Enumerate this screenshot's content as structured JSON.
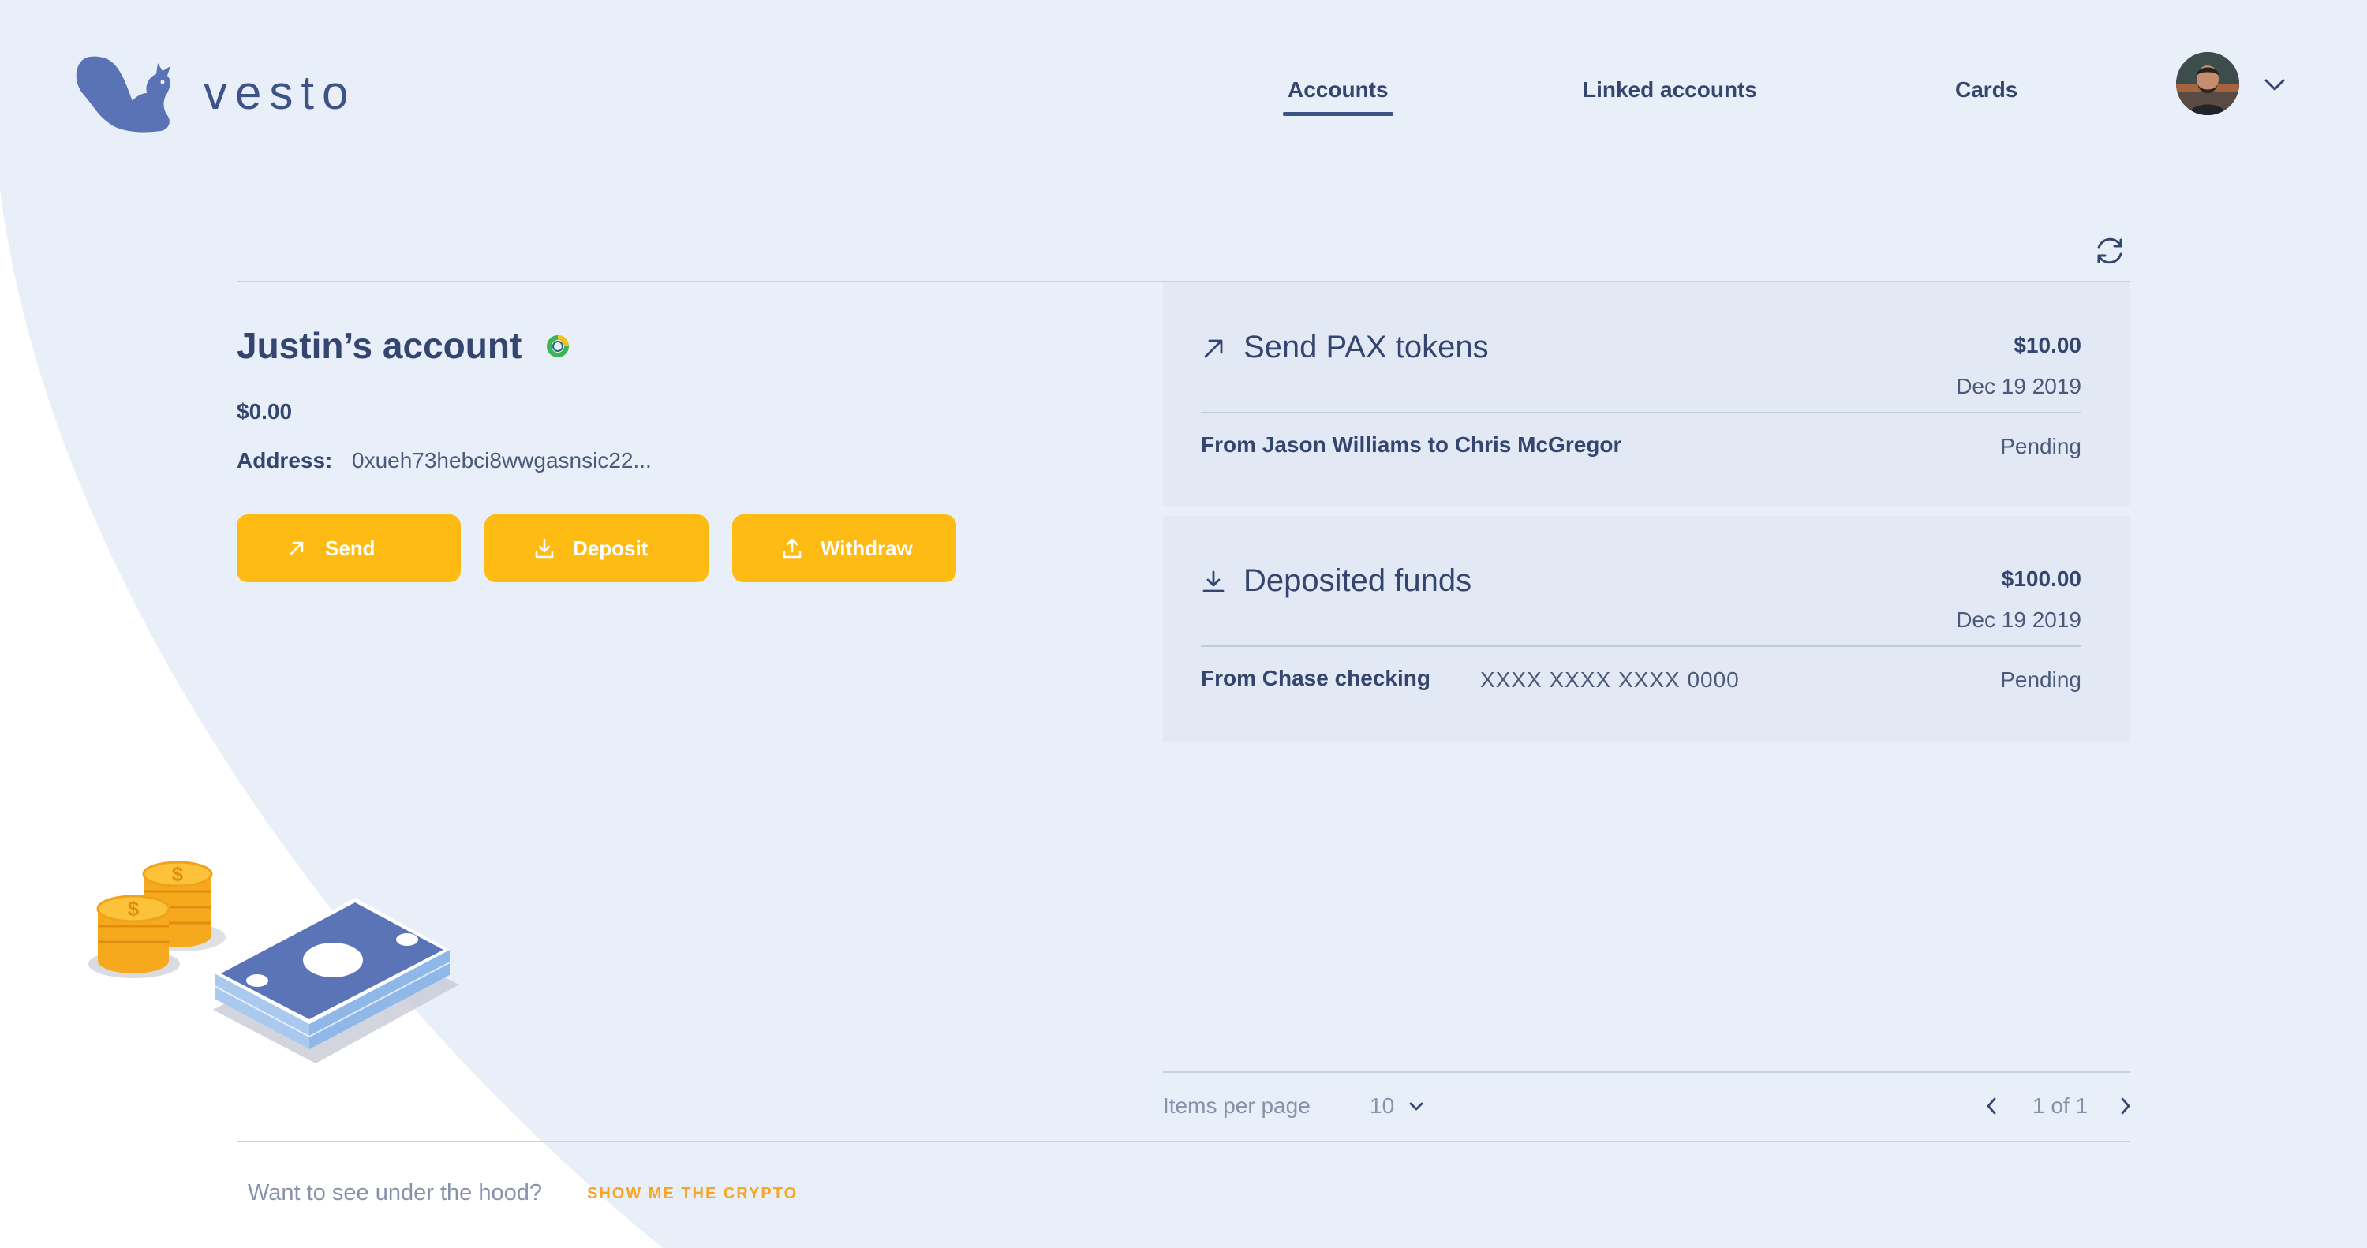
{
  "brand": {
    "name": "vesto"
  },
  "nav": {
    "accounts": "Accounts",
    "linked_accounts": "Linked accounts",
    "cards": "Cards"
  },
  "account": {
    "title": "Justin’s account",
    "balance": "$0.00",
    "address_label": "Address:",
    "address_value": "0xueh73hebci8wwgasnsic22..."
  },
  "actions": {
    "send": "Send",
    "deposit": "Deposit",
    "withdraw": "Withdraw"
  },
  "transactions": [
    {
      "icon": "arrow-up-right-icon",
      "title": "Send PAX tokens",
      "amount": "$10.00",
      "date": "Dec 19 2019",
      "from": "From Jason Williams to Chris McGregor",
      "status": "Pending"
    },
    {
      "icon": "download-icon",
      "title": "Deposited funds",
      "amount": "$100.00",
      "date": "Dec 19 2019",
      "from": "From Chase checking",
      "account_number": "XXXX XXXX XXXX 0000",
      "status": "Pending"
    }
  ],
  "pagination": {
    "items_per_page_label": "Items per page",
    "items_per_page_value": "10",
    "page_info": "1 of 1"
  },
  "footer": {
    "question": "Want to see under the hood?",
    "link": "SHOW ME THE CRYPTO"
  },
  "colors": {
    "background": "#e9eff8",
    "accent": "#fdbb14",
    "primary_text": "#34466f",
    "card_background": "#e3e9f4",
    "link": "#f5a623"
  }
}
